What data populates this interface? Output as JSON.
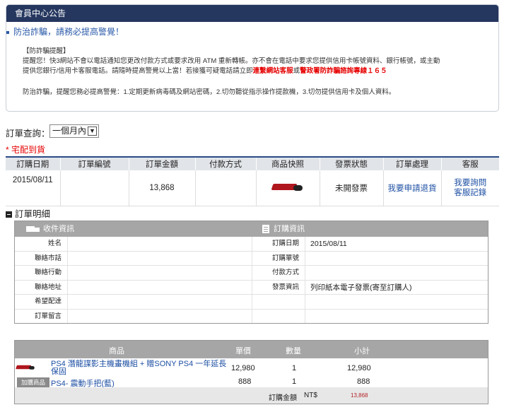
{
  "notice": {
    "title": "會員中心公告",
    "subtitle": "防治詐騙，請務必提高警覺！",
    "bracket_title": "【防詐騙提醒】",
    "line1": "提醒您！快3網站不會以電話通知您更改付款方式或要求改用 ATM 重新轉帳。亦不會在電話中要求您提供信用卡帳號資料、銀行帳號，或主動",
    "line2a": "提供您銀行/信用卡客服電話。請隨時提高警覺以上當！若接獲可疑電話請立即",
    "line2b": "連繫網站客服",
    "line2c": "或",
    "line2d": "警政署防詐騙諮詢專線１６５",
    "tips": "防治詐騙，提醒您務必提高警覺：1.定期更新病毒碼及網站密碼，2.切勿聽從指示操作提款機，3.切勿提供信用卡及個人資料。"
  },
  "order_query": {
    "label": "訂單查詢：",
    "selected": "一個月內"
  },
  "delivery_label": "* 宅配到貨",
  "orders": {
    "headers": [
      "訂購日期",
      "訂單編號",
      "訂單金額",
      "付款方式",
      "商品快照",
      "發票狀態",
      "訂單處理",
      "客服"
    ],
    "row": {
      "date": "2015/08/11",
      "order_no": "",
      "amount": "13,868",
      "payment": "",
      "invoice_status": "未開發票",
      "action": "我要申請退貨",
      "service1": "我要詢問",
      "service2": "客服記錄"
    }
  },
  "detail_title": "訂單明細",
  "detail": {
    "recv_title": "收件資訊",
    "order_title": "訂購資訊",
    "recv_labels": [
      "姓名",
      "聯絡市話",
      "聯絡行動",
      "聯絡地址",
      "希望配達",
      "訂單留言"
    ],
    "order_labels": [
      "訂購日期",
      "訂購單號",
      "付款方式",
      "發票資訊"
    ],
    "order_values": [
      "2015/08/11",
      "",
      "",
      "列印紙本電子發票(寄至訂購人)"
    ]
  },
  "products": {
    "headers": {
      "item": "商品",
      "price": "單價",
      "qty": "數量",
      "subtotal": "小計"
    },
    "items": [
      {
        "name_line1": "PS4 潛龍諜影主機畫機組 + 贈SONY PS4 一年延長",
        "name_line2": "保固",
        "price": "12,980",
        "qty": "1",
        "subtotal": "12,980"
      },
      {
        "tag": "加購商品",
        "name": "PS4- 震動手把(藍)",
        "price": "888",
        "qty": "1",
        "subtotal": "888"
      }
    ],
    "total_label": "訂購金額",
    "currency": "NT$",
    "total": "13,868"
  }
}
